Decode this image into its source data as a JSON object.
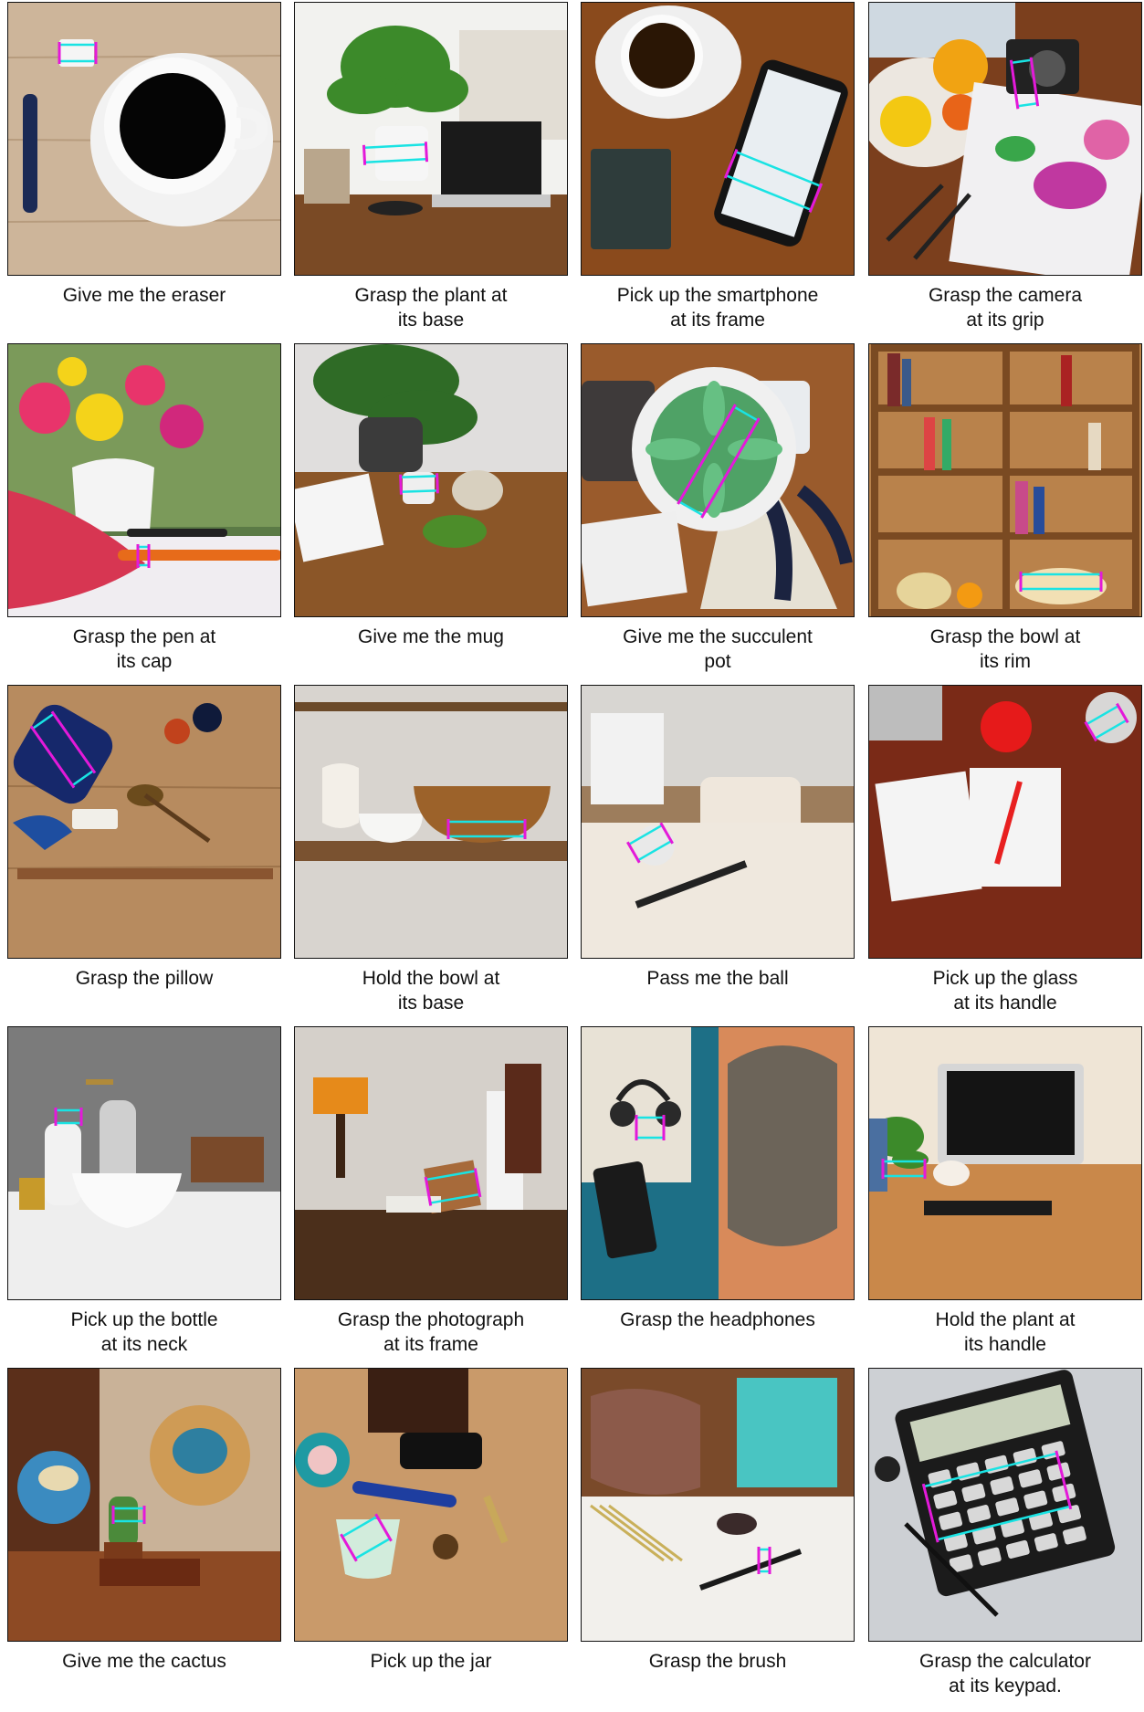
{
  "figure": {
    "panels": [
      {
        "id": "eraser",
        "scene": "coffee cup, eraser and pen on wooden table",
        "caption": [
          "Give me the eraser"
        ]
      },
      {
        "id": "plant-base",
        "scene": "potted plant, books, glasses and laptop on desk",
        "caption": [
          "Grasp the plant at",
          "its base"
        ]
      },
      {
        "id": "smartphone",
        "scene": "coffee cup, notebook and smartphone on wooden table",
        "caption": [
          "Pick up the smartphone",
          "at its frame"
        ]
      },
      {
        "id": "camera",
        "scene": "fruit bowl, camera, brushes and watercolor paper",
        "caption": [
          "Grasp the camera",
          "at its grip"
        ]
      },
      {
        "id": "pen-cap",
        "scene": "flower vase, pink pillow and pens",
        "caption": [
          "Grasp the pen at",
          "its cap"
        ]
      },
      {
        "id": "mug",
        "scene": "potted fern, mug, notebook and pencils on desk",
        "caption": [
          "Give me the mug"
        ]
      },
      {
        "id": "succulent",
        "scene": "succulent pot, calendar and blanket on table",
        "caption": [
          "Give me the succulent",
          "pot"
        ]
      },
      {
        "id": "bowl-rim",
        "scene": "bookshelf with bowls and fruit",
        "caption": [
          "Grasp the bowl at",
          "its rim"
        ]
      },
      {
        "id": "pillow",
        "scene": "navy pillow, tools and jar on wooden floor",
        "caption": [
          "Grasp the pillow"
        ]
      },
      {
        "id": "bowl-base",
        "scene": "vase and bowls on wooden shelf",
        "caption": [
          "Hold the bowl at",
          "its base"
        ]
      },
      {
        "id": "ball",
        "scene": "calendar, mug, ball and pen on desk",
        "caption": [
          "Pass me the ball"
        ]
      },
      {
        "id": "glass",
        "scene": "notebook, red pen, red ball and glass on desk",
        "caption": [
          "Pick up the glass",
          "at its handle"
        ]
      },
      {
        "id": "bottle",
        "scene": "soap bottles, sink basin and cup",
        "caption": [
          "Pick up the bottle",
          "at its neck"
        ]
      },
      {
        "id": "photograph",
        "scene": "lamp, photo frame, book and shelf on desk",
        "caption": [
          "Grasp the photograph",
          "at its frame"
        ]
      },
      {
        "id": "headphones",
        "scene": "headphones, phone and backpack on teal and orange",
        "caption": [
          "Grasp the headphones"
        ]
      },
      {
        "id": "plant-handle",
        "scene": "computer monitor, plant, mug and keyboard on desk",
        "caption": [
          "Hold the plant at",
          "its handle"
        ]
      },
      {
        "id": "cactus",
        "scene": "globes, cactus and books on shelf",
        "caption": [
          "Give me the cactus"
        ]
      },
      {
        "id": "jar",
        "scene": "jar, phone, pen and items on table",
        "caption": [
          "Pick up the jar"
        ]
      },
      {
        "id": "brush",
        "scene": "leather bag, teal wallet, makeup brushes on cloth",
        "caption": [
          "Grasp the brush"
        ]
      },
      {
        "id": "calculator",
        "scene": "calculator, pen and ball on gray surface",
        "caption": [
          "Grasp the calculator",
          "at its keypad."
        ]
      }
    ]
  },
  "colors": {
    "cyan": "#19e3e3",
    "magenta": "#e419d9",
    "border": "#111111"
  }
}
